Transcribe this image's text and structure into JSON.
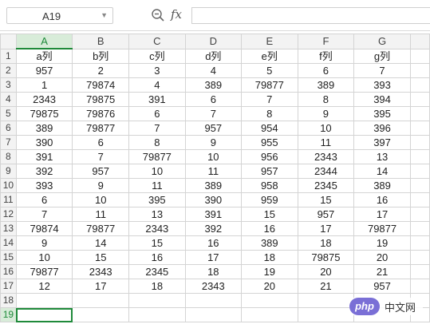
{
  "name_box": {
    "value": "A19"
  },
  "formula_bar": {
    "fx_label": "fx",
    "value": ""
  },
  "columns": [
    "A",
    "B",
    "C",
    "D",
    "E",
    "F",
    "G"
  ],
  "selected_column": "A",
  "selected_row": "19",
  "rows": [
    {
      "num": "1",
      "cells": [
        "a列",
        "b列",
        "c列",
        "d列",
        "e列",
        "f列",
        "g列"
      ]
    },
    {
      "num": "2",
      "cells": [
        "957",
        "2",
        "3",
        "4",
        "5",
        "6",
        "7"
      ]
    },
    {
      "num": "3",
      "cells": [
        "1",
        "79874",
        "4",
        "389",
        "79877",
        "389",
        "393"
      ]
    },
    {
      "num": "4",
      "cells": [
        "2343",
        "79875",
        "391",
        "6",
        "7",
        "8",
        "394"
      ]
    },
    {
      "num": "5",
      "cells": [
        "79875",
        "79876",
        "6",
        "7",
        "8",
        "9",
        "395"
      ]
    },
    {
      "num": "6",
      "cells": [
        "389",
        "79877",
        "7",
        "957",
        "954",
        "10",
        "396"
      ]
    },
    {
      "num": "7",
      "cells": [
        "390",
        "6",
        "8",
        "9",
        "955",
        "11",
        "397"
      ]
    },
    {
      "num": "8",
      "cells": [
        "391",
        "7",
        "79877",
        "10",
        "956",
        "2343",
        "13"
      ]
    },
    {
      "num": "9",
      "cells": [
        "392",
        "957",
        "10",
        "11",
        "957",
        "2344",
        "14"
      ]
    },
    {
      "num": "10",
      "cells": [
        "393",
        "9",
        "11",
        "389",
        "958",
        "2345",
        "389"
      ]
    },
    {
      "num": "11",
      "cells": [
        "6",
        "10",
        "395",
        "390",
        "959",
        "15",
        "16"
      ]
    },
    {
      "num": "12",
      "cells": [
        "7",
        "11",
        "13",
        "391",
        "15",
        "957",
        "17"
      ]
    },
    {
      "num": "13",
      "cells": [
        "79874",
        "79877",
        "2343",
        "392",
        "16",
        "17",
        "79877"
      ]
    },
    {
      "num": "14",
      "cells": [
        "9",
        "14",
        "15",
        "16",
        "389",
        "18",
        "19"
      ]
    },
    {
      "num": "15",
      "cells": [
        "10",
        "15",
        "16",
        "17",
        "18",
        "79875",
        "20"
      ]
    },
    {
      "num": "16",
      "cells": [
        "79877",
        "2343",
        "2345",
        "18",
        "19",
        "20",
        "21"
      ]
    },
    {
      "num": "17",
      "cells": [
        "12",
        "17",
        "18",
        "2343",
        "20",
        "21",
        "957"
      ]
    },
    {
      "num": "18",
      "cells": [
        "",
        "",
        "",
        "",
        "",
        "",
        ""
      ]
    },
    {
      "num": "19",
      "cells": [
        "",
        "",
        "",
        "",
        "",
        "",
        ""
      ]
    }
  ],
  "watermark": {
    "logo": "php",
    "text": "中文网"
  }
}
